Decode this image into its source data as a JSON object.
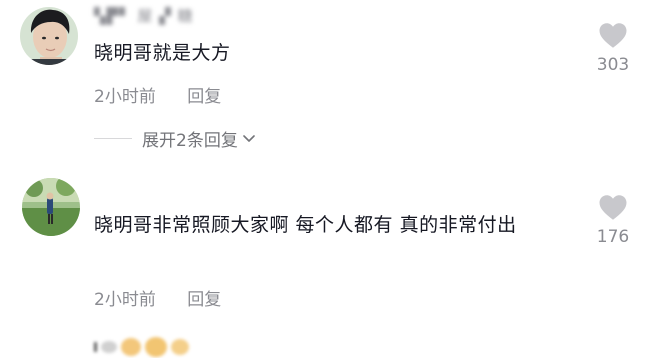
{
  "comments": [
    {
      "username": "▚▛▘ 屋 ▞ 糖",
      "text": "晓明哥就是大方",
      "time": "2小时前",
      "reply_label": "回复",
      "likes": "303"
    },
    {
      "username": "",
      "text": "晓明哥非常照顾大家啊 每个人都有 真的非常付出",
      "time": "2小时前",
      "reply_label": "回复",
      "likes": "176"
    }
  ],
  "expand_replies": {
    "label": "展开2条回复"
  },
  "colors": {
    "text_primary": "#161823",
    "text_secondary": "#8a8b91",
    "icon_gray": "#c8c8cc",
    "background": "#ffffff"
  },
  "icons": {
    "like": "heart-icon",
    "expand": "chevron-down-icon"
  }
}
